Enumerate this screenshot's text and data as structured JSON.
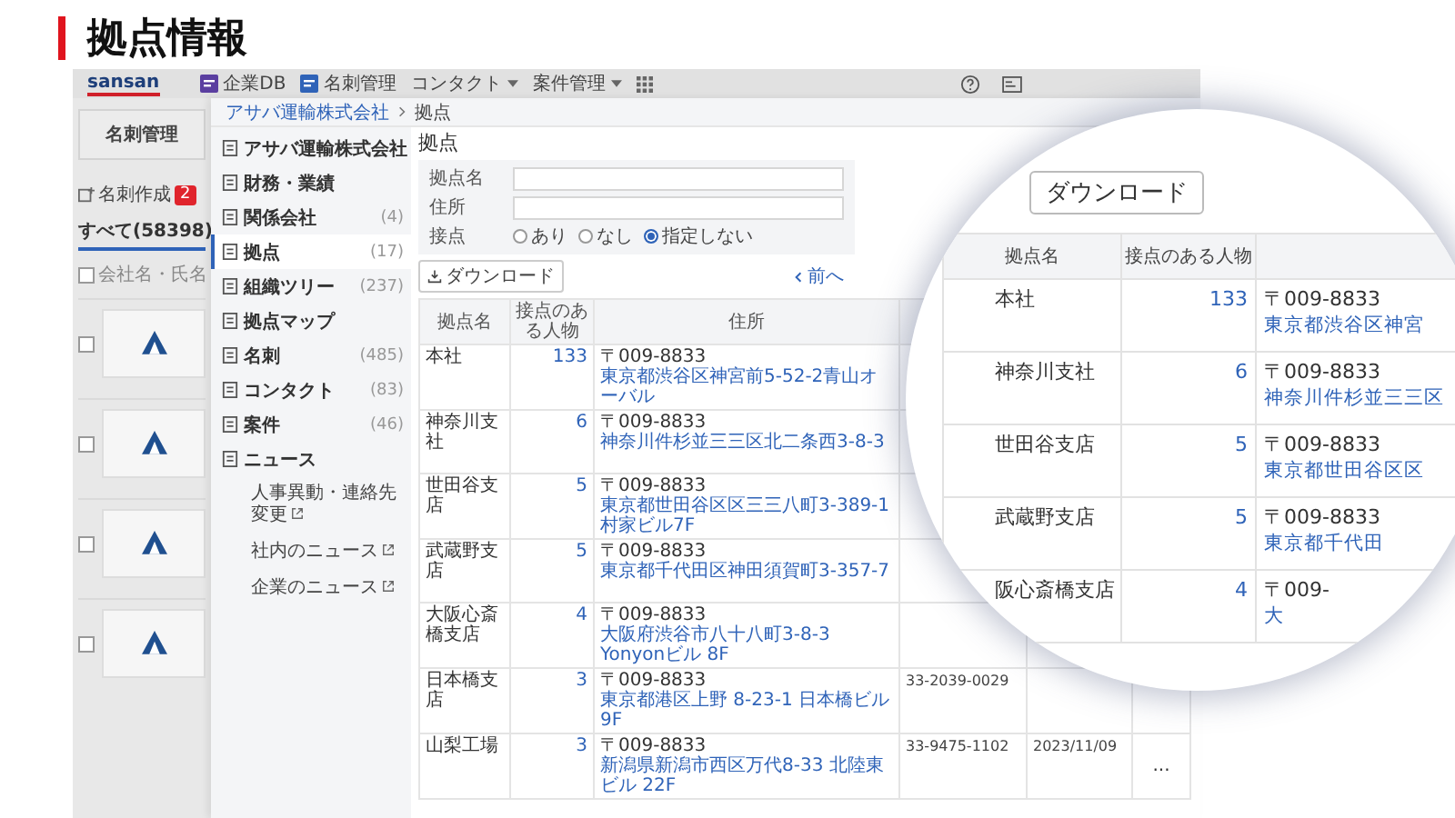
{
  "title": "拠点情報",
  "nav": {
    "logo": "sansan",
    "items": [
      {
        "label": "企業DB",
        "kind": "app"
      },
      {
        "label": "名刺管理",
        "kind": "app"
      },
      {
        "label": "コンタクト",
        "kind": "menu"
      },
      {
        "label": "案件管理",
        "kind": "menu"
      }
    ]
  },
  "left_pane": {
    "card_title": "名刺管理",
    "create_label": "名刺作成",
    "create_badge": "2",
    "tab": "すべて(58398)",
    "select_all_label": "会社名・氏名",
    "select_all_checked": false,
    "cards": [
      {
        "checked": false
      },
      {
        "checked": false
      },
      {
        "checked": false
      },
      {
        "checked": false
      }
    ]
  },
  "breadcrumb": [
    "アサバ運輸株式会社",
    "拠点"
  ],
  "sidebar": {
    "items": [
      {
        "label": "アサバ運輸株式会社",
        "selected": false
      },
      {
        "label": "財務・業績",
        "selected": false
      },
      {
        "label": "関係会社",
        "count": "(4)",
        "selected": false
      },
      {
        "label": "拠点",
        "count": "(17)",
        "selected": true
      },
      {
        "label": "組織ツリー",
        "count": "(237)",
        "selected": false
      },
      {
        "label": "拠点マップ",
        "selected": false
      },
      {
        "label": "名刺",
        "count": "(485)",
        "selected": false
      },
      {
        "label": "コンタクト",
        "count": "(83)",
        "selected": false
      },
      {
        "label": "案件",
        "count": "(46)",
        "selected": false
      },
      {
        "label": "ニュース",
        "selected": false,
        "children": [
          {
            "label": "人事異動・連絡先変更"
          },
          {
            "label": "社内のニュース"
          },
          {
            "label": "企業のニュース"
          }
        ]
      }
    ]
  },
  "main": {
    "heading": "拠点",
    "filters": [
      {
        "label": "拠点名",
        "kind": "text"
      },
      {
        "label": "住所",
        "kind": "text"
      },
      {
        "label": "接点",
        "kind": "radio",
        "options": [
          {
            "label": "あり",
            "selected": false
          },
          {
            "label": "なし",
            "selected": false
          },
          {
            "label": "指定しない",
            "selected": true
          }
        ]
      }
    ],
    "download": "ダウンロード",
    "prev": "前へ",
    "table": {
      "columns": [
        "拠点名",
        "接点のある人物",
        "住所"
      ],
      "rows": [
        {
          "name": "本社",
          "count": "133",
          "postal": "〒009-8833",
          "address": "東京都渋谷区神宮前5-52-2青山オーバル"
        },
        {
          "name": "神奈川支社",
          "count": "6",
          "postal": "〒009-8833",
          "address": "神奈川件杉並三三区北二条西3-8-3"
        },
        {
          "name": "世田谷支店",
          "count": "5",
          "postal": "〒009-8833",
          "address": "東京都世田谷区区三三八町3-389-1 村家ビル7F"
        },
        {
          "name": "武蔵野支店",
          "count": "5",
          "postal": "〒009-8833",
          "address": "東京都千代田区神田須賀町3-357-7"
        },
        {
          "name": "大阪心斎橋支店",
          "count": "4",
          "postal": "〒009-8833",
          "address": "大阪府渋谷市八十八町3-8-3 Yonyonビル 8F"
        },
        {
          "name": "日本橋支店",
          "count": "3",
          "postal": "〒009-8833",
          "address": "東京都港区上野 8-23-1 日本橋ビル 9F",
          "phone": "33-2039-0029"
        },
        {
          "name": "山梨工場",
          "count": "3",
          "postal": "〒009-8833",
          "address": "新潟県新潟市西区万代8-33 北陸東ビル 22F",
          "phone": "33-9475-1102",
          "date": "2023/11/09",
          "action": "..."
        }
      ]
    }
  },
  "magnifier": {
    "download": "ダウンロード",
    "columns": [
      "拠点名",
      "接点のある人物"
    ],
    "rows": [
      {
        "name": "本社",
        "count": "133",
        "postal": "〒009-8833",
        "address": "東京都渋谷区神宮"
      },
      {
        "name": "神奈川支社",
        "count": "6",
        "postal": "〒009-8833",
        "address": "神奈川件杉並三三区"
      },
      {
        "name": "世田谷支店",
        "count": "5",
        "postal": "〒009-8833",
        "address": "東京都世田谷区区"
      },
      {
        "name": "武蔵野支店",
        "count": "5",
        "postal": "〒009-8833",
        "address": "東京都千代田"
      },
      {
        "name": "阪心斎橋支店",
        "count": "4",
        "postal": "〒009-",
        "address": "大"
      }
    ]
  }
}
